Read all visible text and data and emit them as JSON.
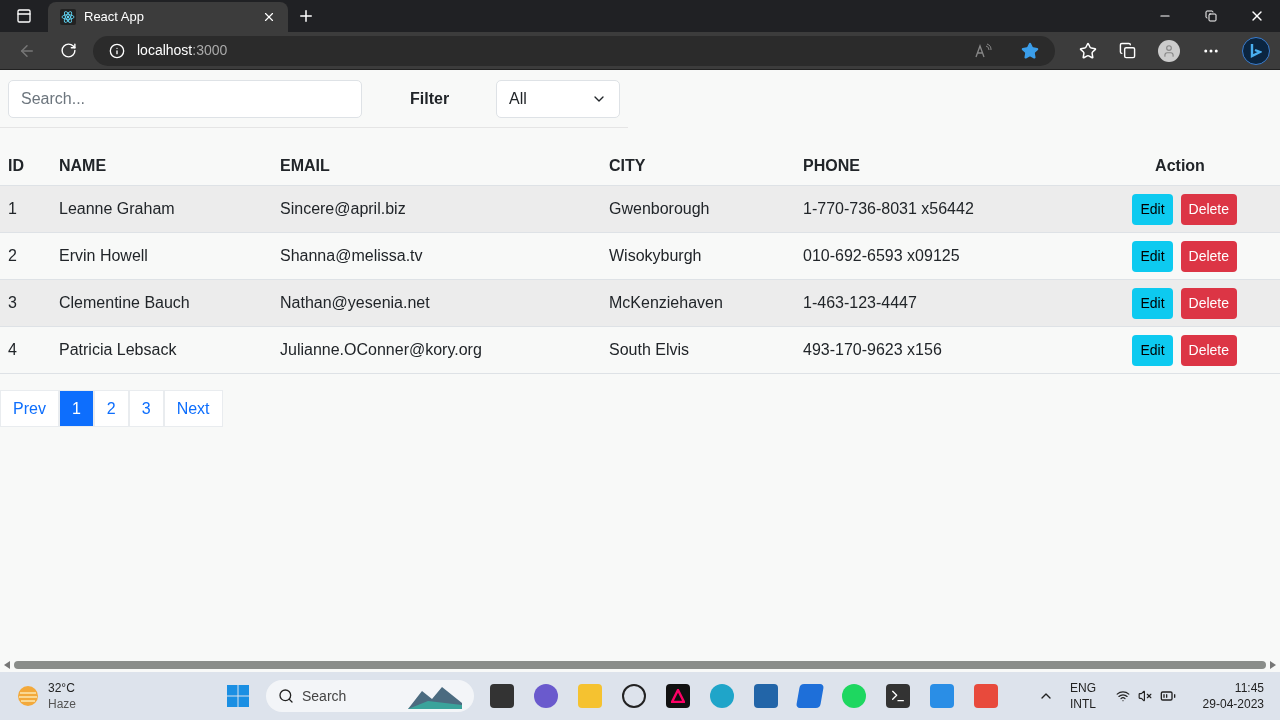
{
  "browser": {
    "tab_title": "React App",
    "url_host": "localhost",
    "url_port": ":3000"
  },
  "toolbar": {
    "search_placeholder": "Search...",
    "filter_label": "Filter",
    "filter_value": "All"
  },
  "table": {
    "columns": [
      "ID",
      "NAME",
      "EMAIL",
      "CITY",
      "PHONE",
      "Action"
    ],
    "rows": [
      {
        "cells": [
          "1",
          "Leanne Graham",
          "Sincere@april.biz",
          "Gwenborough",
          "1-770-736-8031 x56442"
        ],
        "actions": [
          "Edit",
          "Delete"
        ]
      },
      {
        "cells": [
          "2",
          "Ervin Howell",
          "Shanna@melissa.tv",
          "Wisokyburgh",
          "010-692-6593 x09125"
        ],
        "actions": [
          "Edit",
          "Delete"
        ]
      },
      {
        "cells": [
          "3",
          "Clementine Bauch",
          "Nathan@yesenia.net",
          "McKenziehaven",
          "1-463-123-4447"
        ],
        "actions": [
          "Edit",
          "Delete"
        ]
      },
      {
        "cells": [
          "4",
          "Patricia Lebsack",
          "Julianne.OConner@kory.org",
          "South Elvis",
          "493-170-9623 x156"
        ],
        "actions": [
          "Edit",
          "Delete"
        ]
      }
    ]
  },
  "pagination": [
    {
      "label": "Prev",
      "selected": false
    },
    {
      "label": "1",
      "selected": true
    },
    {
      "label": "2",
      "selected": false
    },
    {
      "label": "3",
      "selected": false
    },
    {
      "label": "Next",
      "selected": false
    }
  ],
  "taskbar": {
    "temperature": "32°C",
    "weather": "Haze",
    "search_placeholder": "Search",
    "language": "ENG",
    "layout": "INTL",
    "time": "11:45",
    "date": "29-04-2023"
  }
}
